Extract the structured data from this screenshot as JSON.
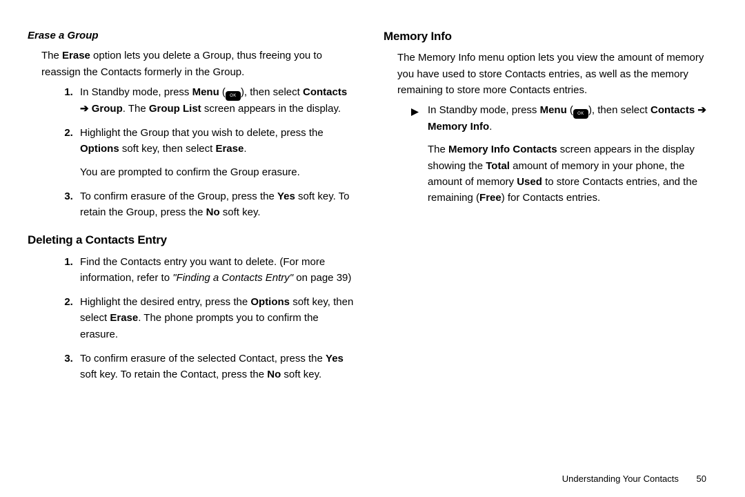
{
  "left": {
    "sub_heading": "Erase a Group",
    "intro_pre": "The ",
    "intro_bold1": "Erase",
    "intro_post": " option lets you delete a Group, thus freeing you to reassign the Contacts formerly in the Group.",
    "s1_a": "In Standby mode, press ",
    "s1_menu": "Menu",
    "s1_paren_open": " (",
    "s1_paren_close": "), then select ",
    "s1_contacts": "Contacts",
    "s1_arrow": " ➔ ",
    "s1_group": "Group",
    "s1_b": ". The ",
    "s1_grouplist": "Group List",
    "s1_c": " screen appears in the display.",
    "s2_a": "Highlight the Group that you wish to delete, press the ",
    "s2_options": "Options",
    "s2_b": " soft key, then select ",
    "s2_erase": "Erase",
    "s2_c": ".",
    "s2_confirm": "You are prompted to confirm the Group erasure.",
    "s3_a": "To confirm erasure of the Group, press the ",
    "s3_yes": "Yes",
    "s3_b": " soft key. To retain the Group, press the ",
    "s3_no": "No",
    "s3_c": " soft key.",
    "section2": "Deleting a Contacts Entry",
    "d1_a": "Find the Contacts entry you want to delete. (For more information, refer to ",
    "d1_ref": "\"Finding a Contacts Entry\"",
    "d1_b": "  on page 39)",
    "d2_a": "Highlight the desired entry, press the ",
    "d2_options": "Options",
    "d2_b": " soft key, then select ",
    "d2_erase": "Erase",
    "d2_c": ". The phone prompts you to confirm the erasure.",
    "d3_a": "To confirm erasure of the selected Contact, press the ",
    "d3_yes": "Yes",
    "d3_b": " soft key. To retain the Contact, press the ",
    "d3_no": "No",
    "d3_c": " soft key."
  },
  "right": {
    "heading": "Memory Info",
    "intro": "The Memory Info menu option lets you view the amount of memory you have used to store Contacts entries, as well as the memory remaining to store more Contacts entries.",
    "b1_a": "In Standby mode, press ",
    "b1_menu": "Menu",
    "b1_paren_open": " (",
    "b1_paren_close": "), then select ",
    "b1_contacts": "Contacts",
    "b1_arrow": " ➔ ",
    "b1_meminfo": "Memory Info",
    "b1_dot": ".",
    "p2_a": "The ",
    "p2_mic": "Memory Info Contacts",
    "p2_b": " screen appears in the display showing the ",
    "p2_total": "Total",
    "p2_c": " amount of memory in your phone, the amount of memory ",
    "p2_used": "Used",
    "p2_d": " to store Contacts entries, and the remaining (",
    "p2_free": "Free",
    "p2_e": ") for Contacts entries."
  },
  "footer": {
    "title": "Understanding Your Contacts",
    "page": "50"
  },
  "icon": {
    "ok": "OK"
  }
}
